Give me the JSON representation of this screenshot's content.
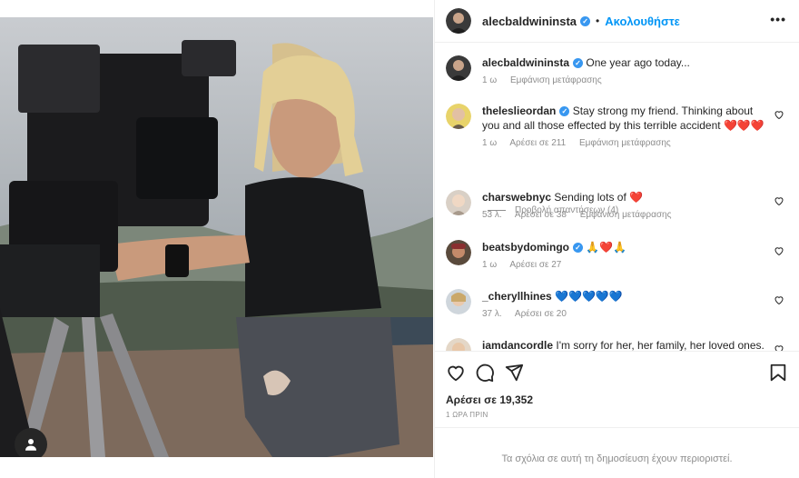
{
  "post": {
    "author": "alecbaldwininsta",
    "follow_label": "Ακολουθήστε",
    "dot": "•",
    "more": "•••",
    "caption": {
      "username": "alecbaldwininsta",
      "text": "One year ago today...",
      "age": "1 ω",
      "translate": "Εμφάνιση μετάφρασης"
    },
    "comments": [
      {
        "username": "theleslieordan",
        "text": "Stay strong my friend. Thinking about you and all those effected by this terrible accident",
        "emoji": "❤️❤️❤️",
        "age": "1 ω",
        "likes": "Αρέσει σε 211",
        "translate": "Εμφάνιση μετάφρασης"
      },
      {
        "username": "charswebnyc",
        "text": "Sending lots of",
        "emoji": "❤️",
        "age": "53 λ.",
        "likes": "Αρέσει σε 38",
        "translate": "Εμφάνιση μετάφρασης"
      },
      {
        "username": "beatsbydomingo",
        "text": "",
        "emoji": "🙏❤️🙏",
        "age": "1 ω",
        "likes": "Αρέσει σε 27"
      },
      {
        "username": "_cheryllhines",
        "text": "",
        "emoji": "💙💙💙💙💙",
        "age": "37 λ.",
        "likes": "Αρέσει σε 20"
      },
      {
        "username": "iamdancordle",
        "text": "I'm sorry for her, her family, her loved ones. I'm"
      }
    ],
    "view_replies": "Προβολή απαντήσεων (4)",
    "like_count": "Αρέσει σε 19,352",
    "timestamp": "1 ΩΡΑ ΠΡΙΝ",
    "restricted_notice": "Τα σχόλια σε αυτή τη δημοσίευση έχουν περιοριστεί."
  },
  "icons": {
    "heart": "heart-icon",
    "comment": "comment-icon",
    "share": "share-icon",
    "save": "bookmark-icon",
    "user_tag": "user-tag-icon"
  },
  "colors": {
    "link_blue": "#0095f6",
    "verified_blue": "#3897f0",
    "muted": "#8e8e8e"
  }
}
